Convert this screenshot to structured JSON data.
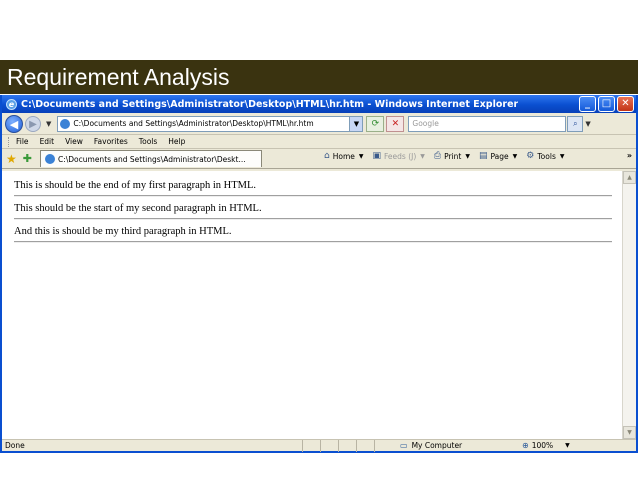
{
  "slide": {
    "title": "Requirement Analysis"
  },
  "window": {
    "title": "C:\\Documents and Settings\\Administrator\\Desktop\\HTML\\hr.htm - Windows Internet Explorer",
    "buttons": {
      "minimize": "_",
      "maximize": "□",
      "close": "✕"
    }
  },
  "address_bar": {
    "url": "C:\\Documents and Settings\\Administrator\\Desktop\\HTML\\hr.htm",
    "search_placeholder": "Google"
  },
  "menu": {
    "items": [
      "File",
      "Edit",
      "View",
      "Favorites",
      "Tools",
      "Help"
    ]
  },
  "tab": {
    "label": "C:\\Documents and Settings\\Administrator\\Deskt..."
  },
  "command_bar": {
    "home": "Home",
    "feeds": "Feeds (J)",
    "print": "Print",
    "page": "Page",
    "tools": "Tools"
  },
  "content": {
    "paragraphs": [
      "This is should be the end of my first paragraph in HTML.",
      "This should be the start of my second paragraph in HTML.",
      "And this is should be my third paragraph in HTML."
    ]
  },
  "status": {
    "text": "Done",
    "zone": "My Computer",
    "zoom": "100%"
  },
  "colors": {
    "slide_header_bg": "#3a3310",
    "titlebar_blue": "#0a4fd0",
    "chrome_bg": "#ece9d8"
  },
  "icons": [
    "ie-icon",
    "back-arrow-icon",
    "forward-arrow-icon",
    "refresh-icon",
    "stop-icon",
    "search-icon",
    "favorites-star-icon",
    "add-favorite-icon",
    "home-icon",
    "feeds-icon",
    "print-icon",
    "page-icon",
    "tools-icon",
    "computer-icon",
    "zoom-icon"
  ]
}
